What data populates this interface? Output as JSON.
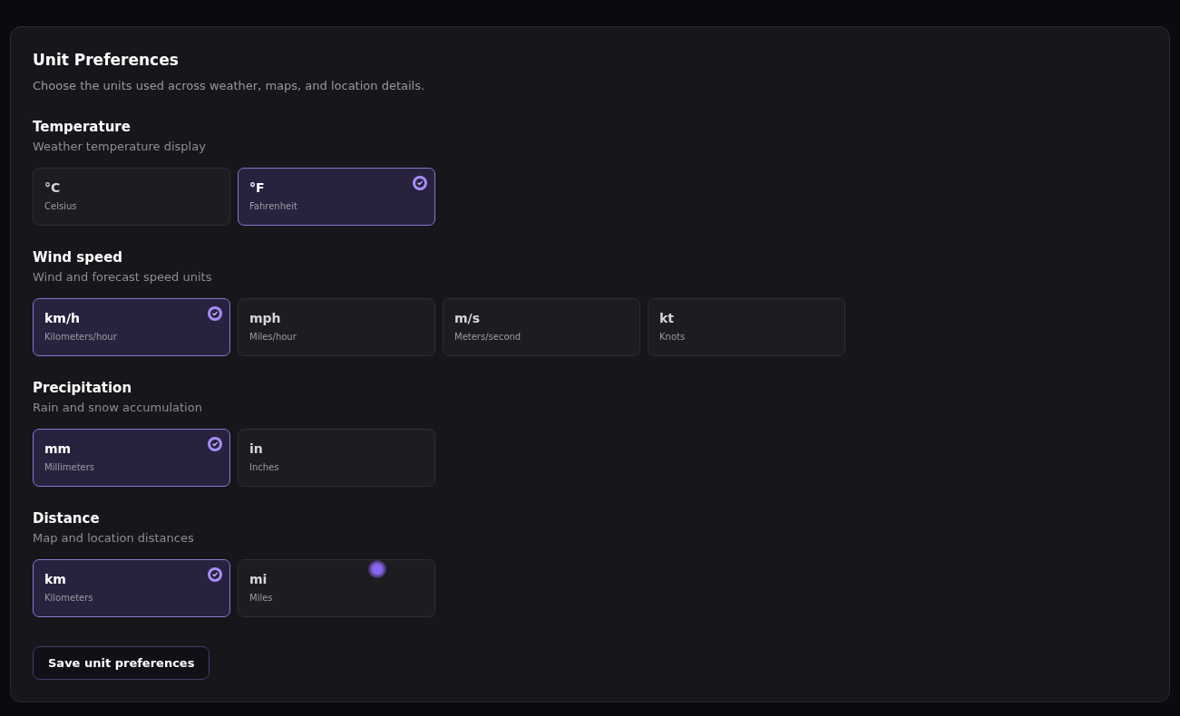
{
  "panel": {
    "title": "Unit Preferences",
    "description": "Choose the units used across weather, maps, and location details."
  },
  "groups": [
    {
      "title": "Temperature",
      "description": "Weather temperature display",
      "options": [
        {
          "symbol": "°C",
          "label": "Celsius",
          "selected": false
        },
        {
          "symbol": "°F",
          "label": "Fahrenheit",
          "selected": true
        }
      ]
    },
    {
      "title": "Wind speed",
      "description": "Wind and forecast speed units",
      "options": [
        {
          "symbol": "km/h",
          "label": "Kilometers/hour",
          "selected": true
        },
        {
          "symbol": "mph",
          "label": "Miles/hour",
          "selected": false
        },
        {
          "symbol": "m/s",
          "label": "Meters/second",
          "selected": false
        },
        {
          "symbol": "kt",
          "label": "Knots",
          "selected": false
        }
      ]
    },
    {
      "title": "Precipitation",
      "description": "Rain and snow accumulation",
      "options": [
        {
          "symbol": "mm",
          "label": "Millimeters",
          "selected": true
        },
        {
          "symbol": "in",
          "label": "Inches",
          "selected": false
        }
      ]
    },
    {
      "title": "Distance",
      "description": "Map and location distances",
      "options": [
        {
          "symbol": "km",
          "label": "Kilometers",
          "selected": true
        },
        {
          "symbol": "mi",
          "label": "Miles",
          "selected": false
        }
      ]
    }
  ],
  "save_button": {
    "label": "Save unit preferences"
  }
}
